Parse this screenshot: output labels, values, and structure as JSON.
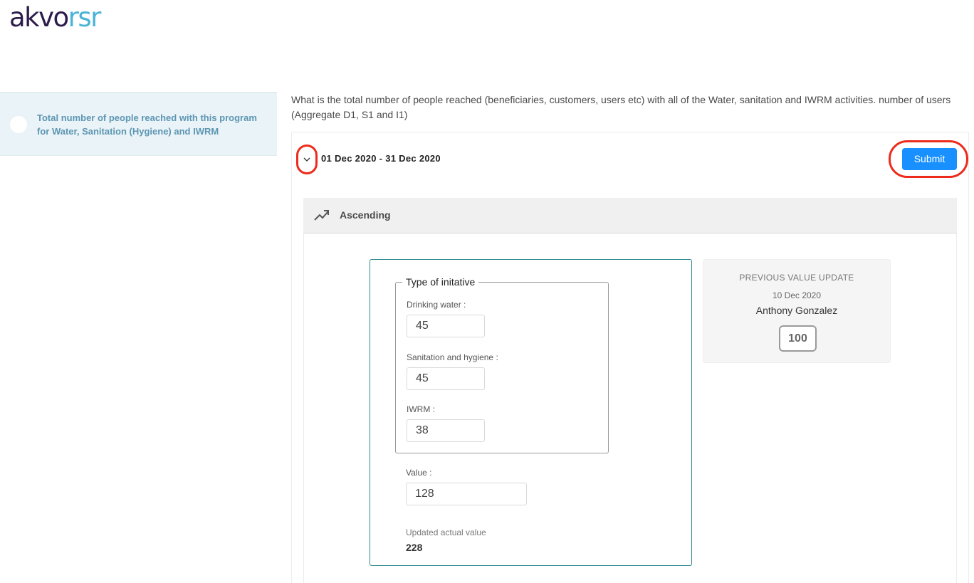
{
  "logo": {
    "part1": "akvo",
    "part2": "rsr"
  },
  "sidebar": {
    "items": [
      {
        "label": "Total number of people reached with this program for Water, Sanitation (Hygiene) and IWRM"
      }
    ]
  },
  "indicator": {
    "question": "What is the total number of people reached (beneficiaries, customers, users etc) with all of the Water, sanitation and IWRM activities. number of users (Aggregate D1, S1 and I1)",
    "period": "01 Dec 2020 - 31 Dec 2020",
    "submit_label": "Submit",
    "direction_label": "Ascending"
  },
  "form": {
    "fieldset_legend": "Type of initative",
    "fields": [
      {
        "label": "Drinking water",
        "value": "45"
      },
      {
        "label": "Sanitation and hygiene",
        "value": "45"
      },
      {
        "label": "IWRM",
        "value": "38"
      }
    ],
    "value_label": "Value",
    "value": "128",
    "updated_label": "Updated actual value",
    "updated_value": "228"
  },
  "previous": {
    "title": "PREVIOUS VALUE UPDATE",
    "date": "10 Dec 2020",
    "user": "Anthony Gonzalez",
    "value": "100"
  },
  "icons": {
    "expand": "chevron-down-icon",
    "direction": "trending-up-icon"
  },
  "colors": {
    "primary": "#1890ff",
    "highlight": "#ec2b1c",
    "card_border": "#2c8a8c",
    "logo_dark": "#2d1c4c",
    "logo_light": "#49b3d8"
  }
}
